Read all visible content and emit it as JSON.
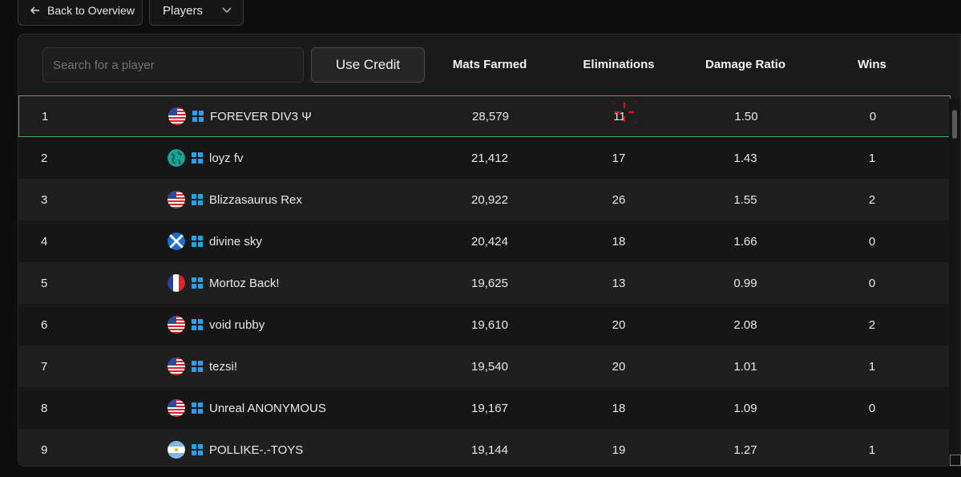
{
  "topbar": {
    "back_label": "Back to Overview",
    "view_select": "Players"
  },
  "toolbar": {
    "search_placeholder": "Search for a player",
    "credit_label": "Use Credit"
  },
  "columns": [
    "Mats Farmed",
    "Eliminations",
    "Damage Ratio",
    "Wins"
  ],
  "colors": {
    "selected_border": "#4caf50",
    "windows_icon": "#1fa3ec"
  },
  "rows": [
    {
      "rank": "1",
      "flag": "us-flag",
      "name": "FOREVER DIV3 Ψ",
      "mats": "28,579",
      "elims": "11",
      "dmg": "1.50",
      "wins": "0"
    },
    {
      "rank": "2",
      "flag": "globe",
      "name": "loyz fv",
      "mats": "21,412",
      "elims": "17",
      "dmg": "1.43",
      "wins": "1"
    },
    {
      "rank": "3",
      "flag": "us-flag",
      "name": "Blizzasaurus Rex",
      "mats": "20,922",
      "elims": "26",
      "dmg": "1.55",
      "wins": "2"
    },
    {
      "rank": "4",
      "flag": "scotland-flag",
      "name": "divine sky",
      "mats": "20,424",
      "elims": "18",
      "dmg": "1.66",
      "wins": "0"
    },
    {
      "rank": "5",
      "flag": "france-flag",
      "name": "Mortoz Back!",
      "mats": "19,625",
      "elims": "13",
      "dmg": "0.99",
      "wins": "0"
    },
    {
      "rank": "6",
      "flag": "us-flag",
      "name": "void rubby",
      "mats": "19,610",
      "elims": "20",
      "dmg": "2.08",
      "wins": "2"
    },
    {
      "rank": "7",
      "flag": "us-flag",
      "name": "tezsi!",
      "mats": "19,540",
      "elims": "20",
      "dmg": "1.01",
      "wins": "1"
    },
    {
      "rank": "8",
      "flag": "us-flag",
      "name": "Unreal ANONYMOUS",
      "mats": "19,167",
      "elims": "18",
      "dmg": "1.09",
      "wins": "0"
    },
    {
      "rank": "9",
      "flag": "argentina-flag",
      "name": "POLLIKE-.-TOYS",
      "mats": "19,144",
      "elims": "19",
      "dmg": "1.27",
      "wins": "1"
    }
  ]
}
